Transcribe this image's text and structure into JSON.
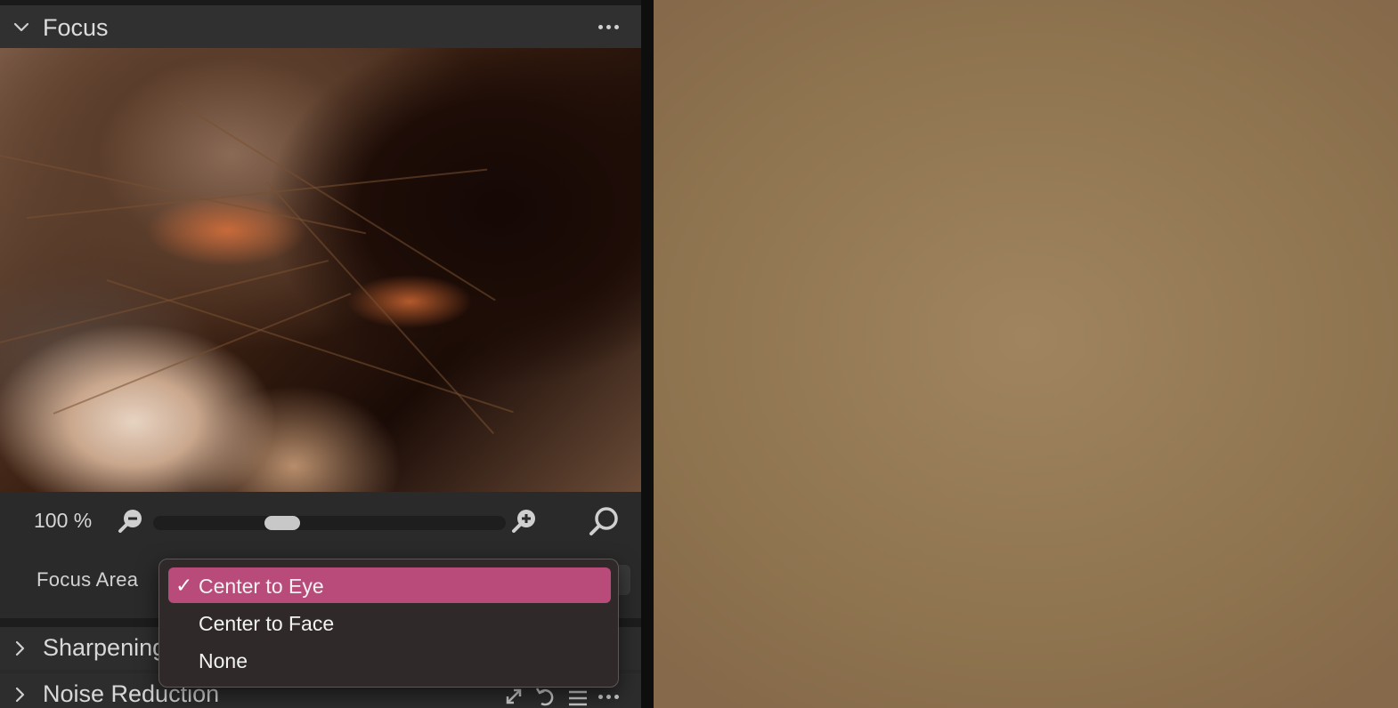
{
  "tool": {
    "title": "Focus",
    "more_icon": "more-icon"
  },
  "zoom": {
    "value_label": "100 %",
    "slider_fraction": 0.35
  },
  "focus_area": {
    "label": "Focus Area",
    "options": [
      {
        "label": "Center to Eye",
        "selected": true,
        "checkmark": "✓"
      },
      {
        "label": "Center to Face",
        "selected": false
      },
      {
        "label": "None",
        "selected": false
      }
    ]
  },
  "sections": [
    {
      "title": "Sharpening"
    },
    {
      "title": "Noise Reduction"
    }
  ],
  "colors": {
    "selection": "#b94b7a",
    "panel": "#2a2a2b",
    "viewer": "#8e734f"
  }
}
